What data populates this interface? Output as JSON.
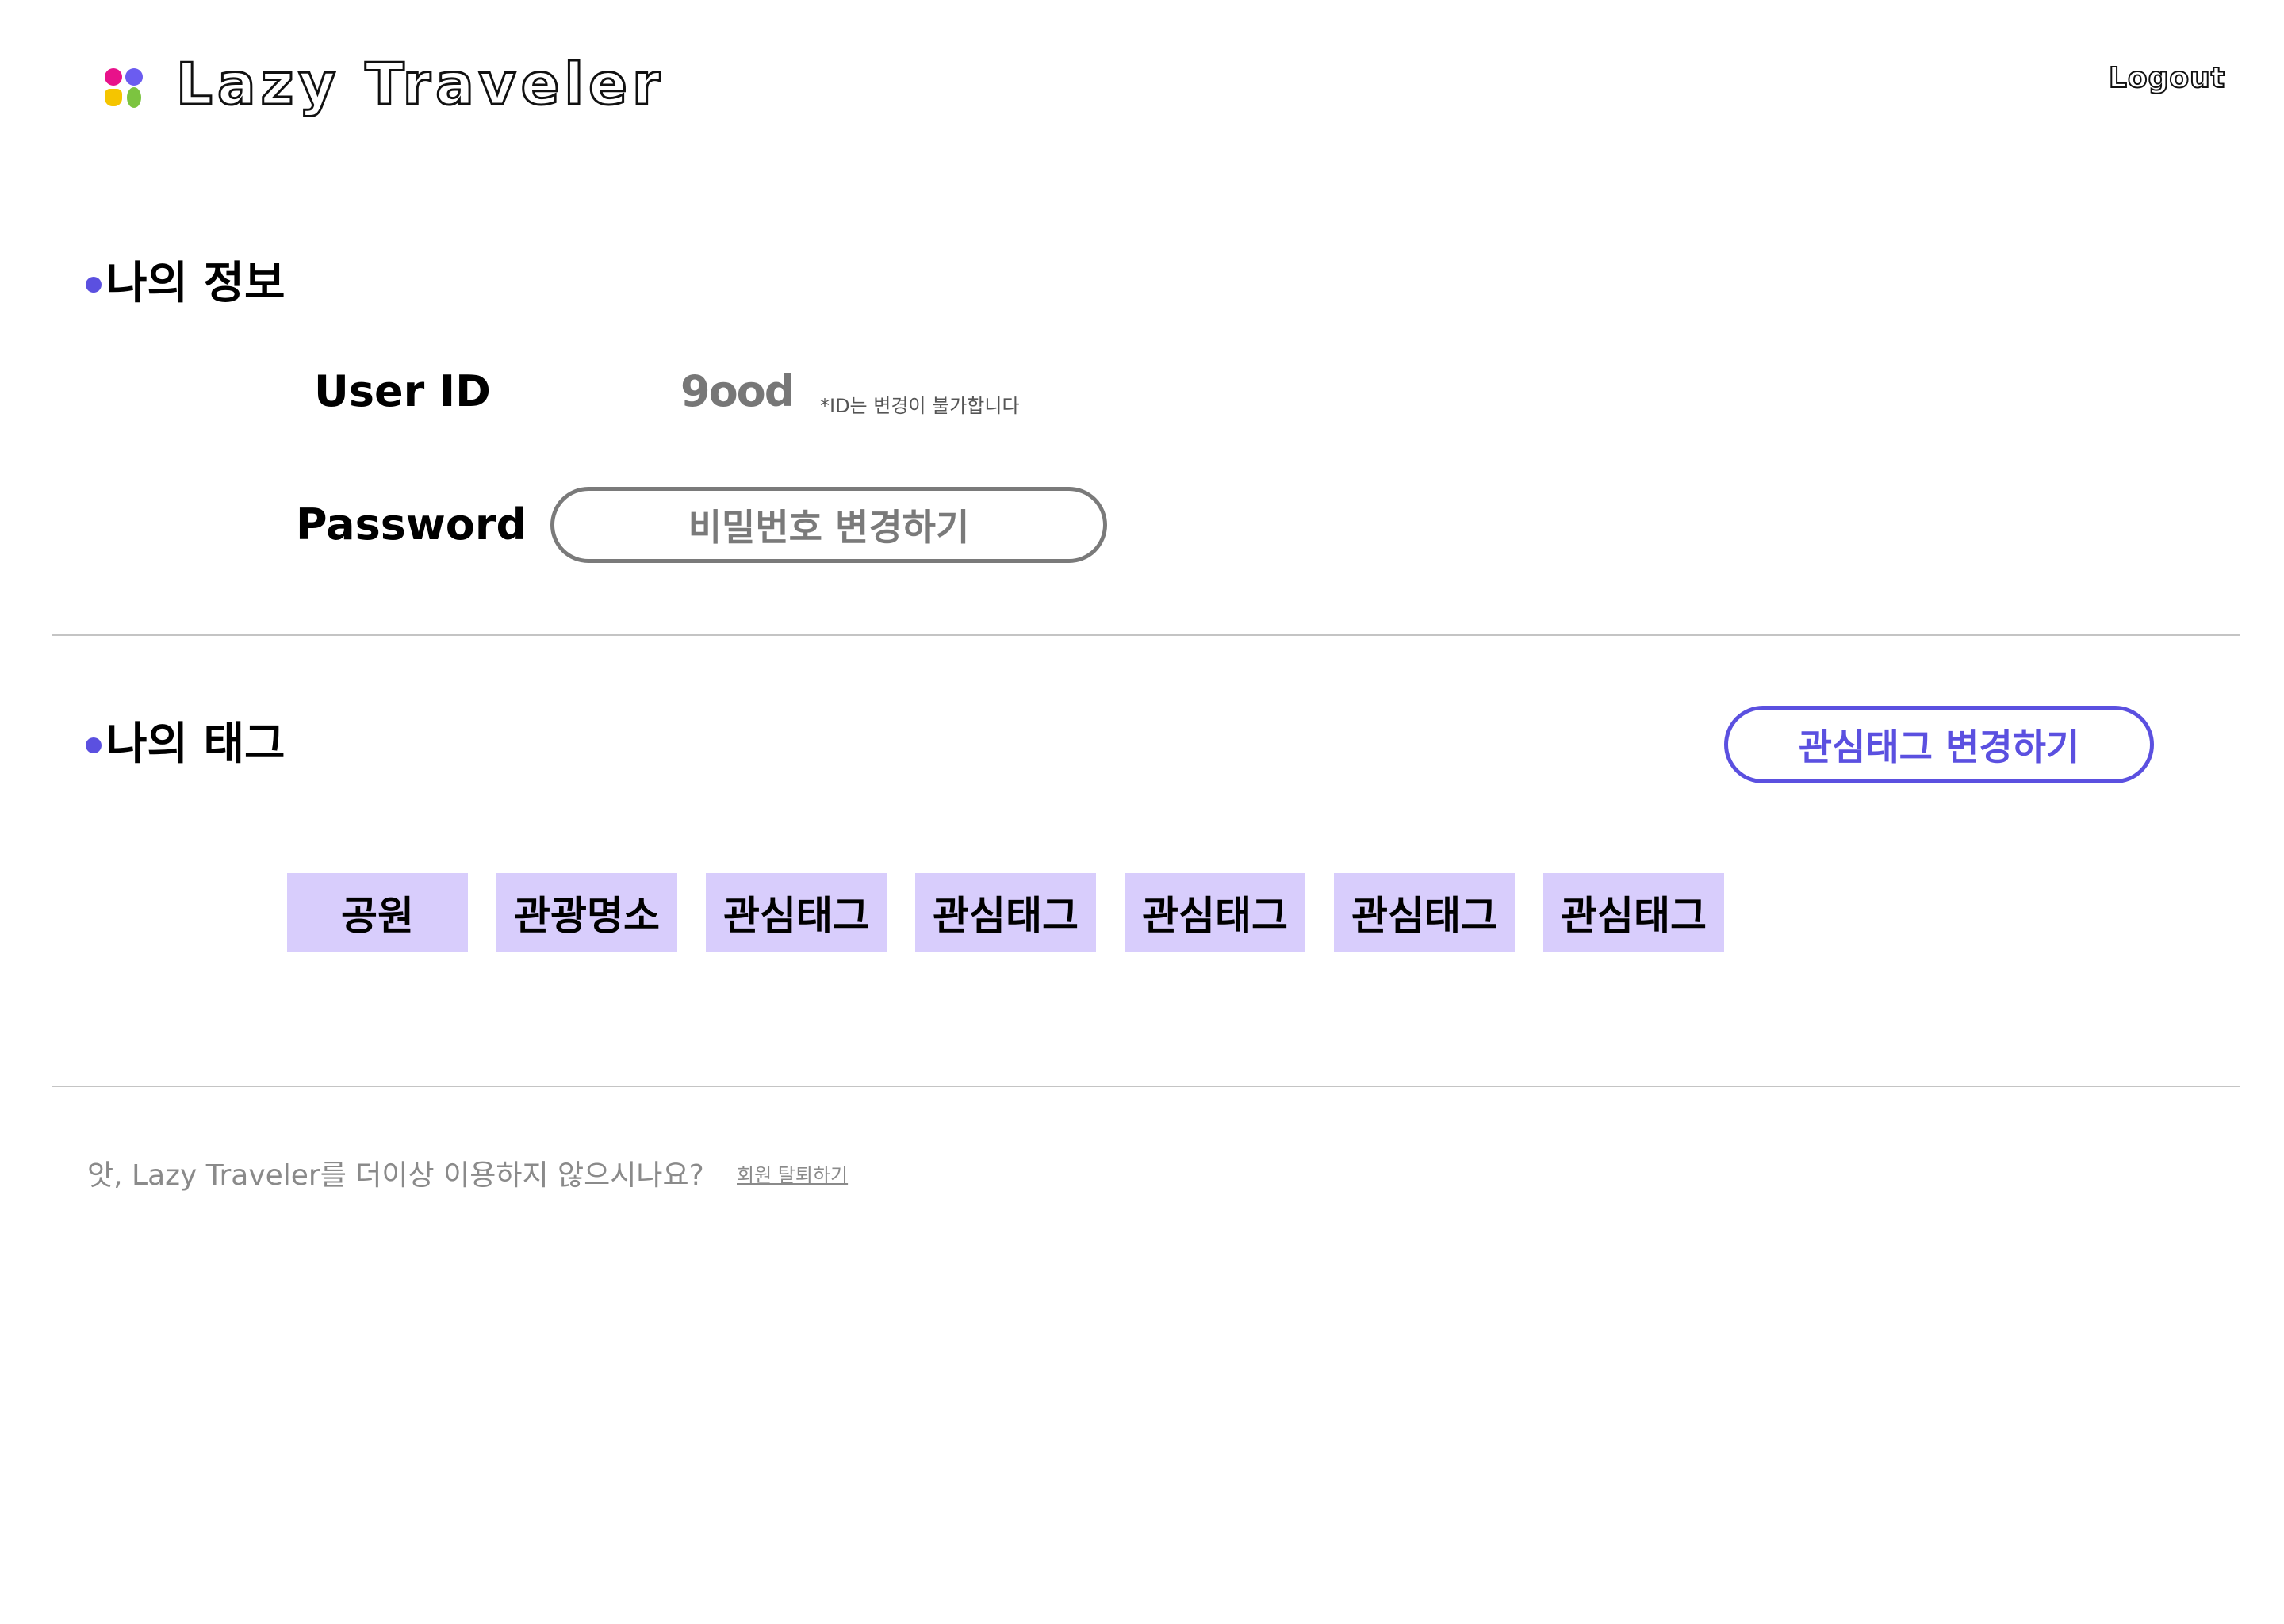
{
  "header": {
    "logo_text": "Lazy Traveler",
    "logout_label": "Logout",
    "logo_colors": [
      "#e8128a",
      "#6b5cf0",
      "#f5c500",
      "#7cc440"
    ]
  },
  "info_section": {
    "title": "나의 정보",
    "userid_label": "User ID",
    "userid_value": "9ood",
    "userid_note": "*ID는 변경이 불가합니다",
    "password_label": "Password",
    "password_button_label": "비밀번호 변경하기"
  },
  "tags_section": {
    "title": "나의 태그",
    "change_button_label": "관심태그 변경하기",
    "tags": [
      "공원",
      "관광명소",
      "관심태그",
      "관심태그",
      "관심태그",
      "관심태그",
      "관심태그"
    ]
  },
  "footer": {
    "withdraw_question": "앗, Lazy Traveler를 더이상 이용하지 않으시나요?",
    "withdraw_link": "회원 탈퇴하기"
  },
  "colors": {
    "accent": "#5b50e0",
    "tag_background": "#d8cdfc",
    "muted_text": "#8a8a8a",
    "divider": "#c4c4c4"
  }
}
